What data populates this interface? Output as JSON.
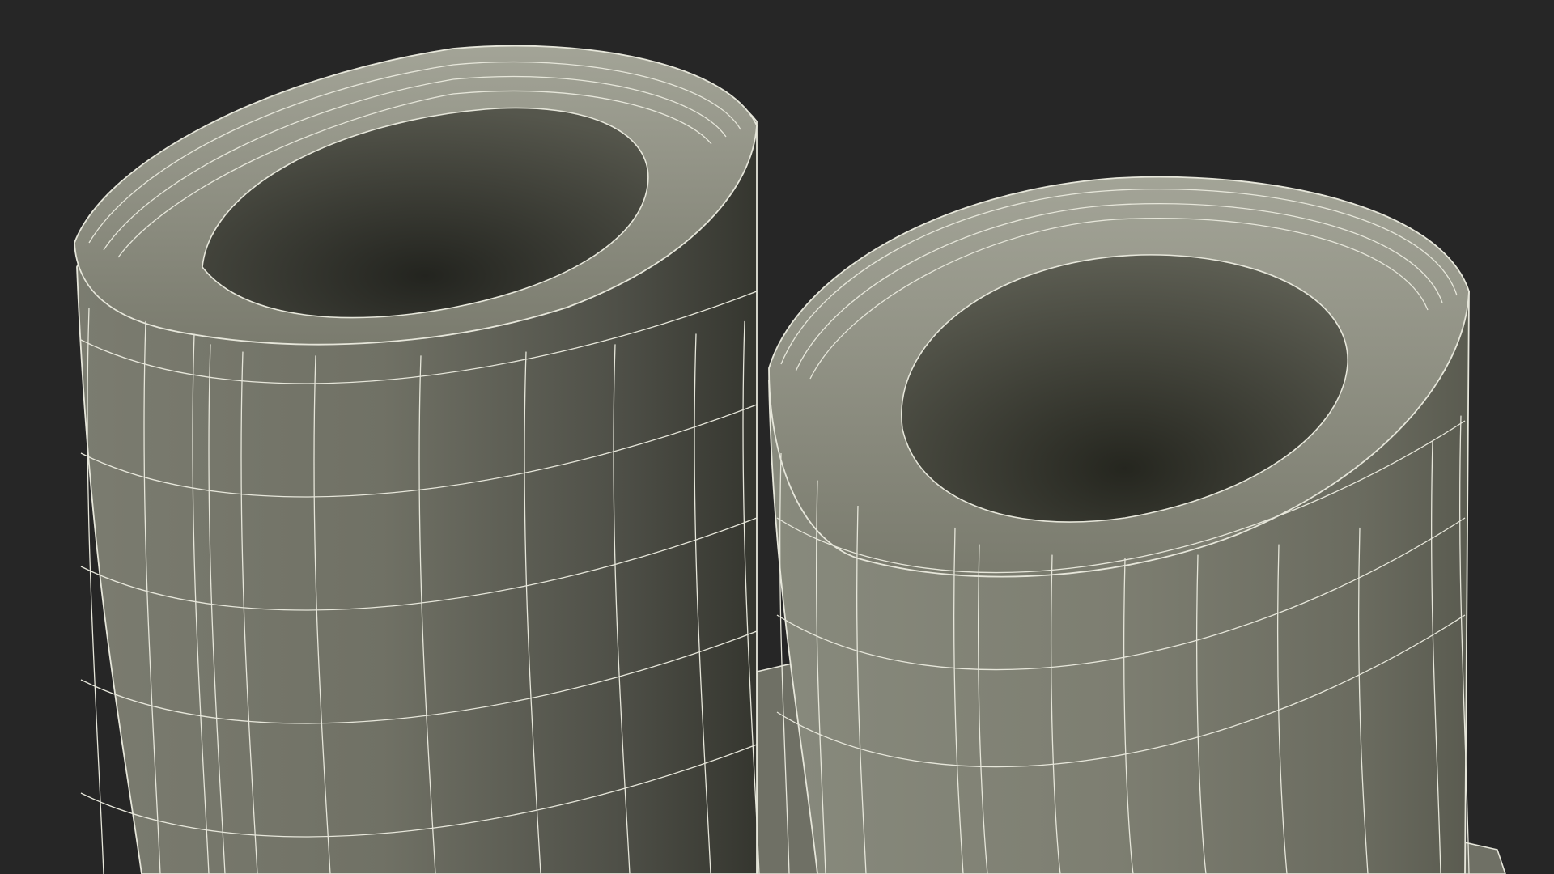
{
  "scene": {
    "background_color": "#262626",
    "subject": "two-rubber-boots-wireframe-render",
    "colors": {
      "shell_light": "#8a8b7e",
      "shell_mid": "#6f7064",
      "shell_dark": "#3a3b35",
      "opening_interior": "#2c2d28",
      "wire": "#e6e6da"
    }
  }
}
